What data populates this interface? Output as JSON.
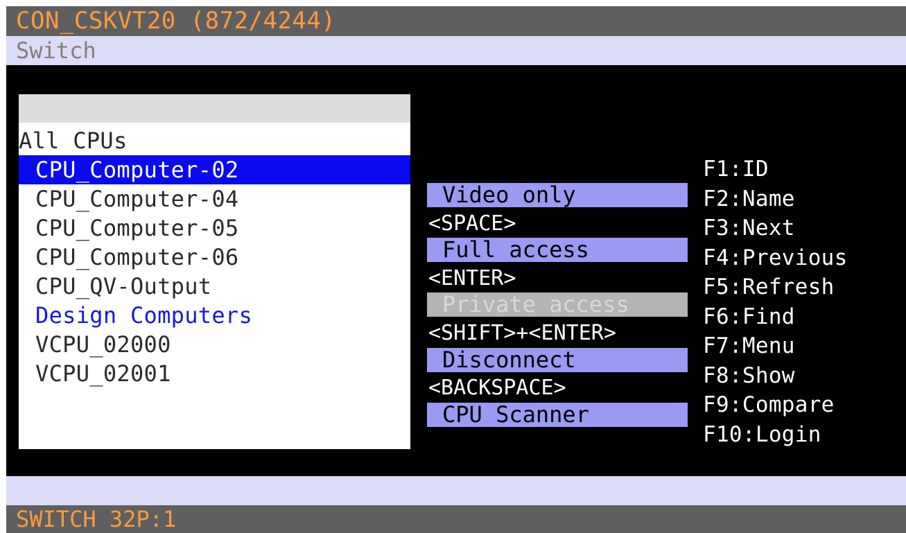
{
  "window": {
    "title": "CON_CSKVT20 (872/4244)",
    "subtitle": "Switch"
  },
  "list": {
    "filter_value": "",
    "items": [
      {
        "label": "All CPUs",
        "state": "group"
      },
      {
        "label": "CPU_Computer-02",
        "state": "selected"
      },
      {
        "label": "CPU_Computer-04",
        "state": "normal"
      },
      {
        "label": "CPU_Computer-05",
        "state": "normal"
      },
      {
        "label": "CPU_Computer-06",
        "state": "normal"
      },
      {
        "label": "CPU_QV-Output",
        "state": "normal"
      },
      {
        "label": "Design Computers",
        "state": "highlight-blue"
      },
      {
        "label": "VCPU_02000",
        "state": "normal"
      },
      {
        "label": "VCPU_02001",
        "state": "normal"
      }
    ]
  },
  "actions": {
    "video_only": "Video only",
    "space_key": "<SPACE>",
    "full_access": "Full access",
    "enter_key": "<ENTER>",
    "private_access": "Private access",
    "shift_enter_key": "<SHIFT>+<ENTER>",
    "disconnect": "Disconnect",
    "backspace_key": "<BACKSPACE>",
    "cpu_scanner": "CPU Scanner"
  },
  "function_keys": [
    "F1:ID",
    "F2:Name",
    "F3:Next",
    "F4:Previous",
    "F5:Refresh",
    "F6:Find",
    "F7:Menu",
    "F8:Show",
    "F9:Compare",
    "F10:Login"
  ],
  "status": {
    "message": "",
    "footer": "SWITCH 32P:1"
  },
  "colors": {
    "title_bg": "#5f5f5f",
    "title_text": "#ff9a3c",
    "header_bg": "#dcdcf8",
    "selection": "#0a0af0",
    "button_bg": "#9a9af2",
    "disabled_bg": "#b4b4b4"
  }
}
